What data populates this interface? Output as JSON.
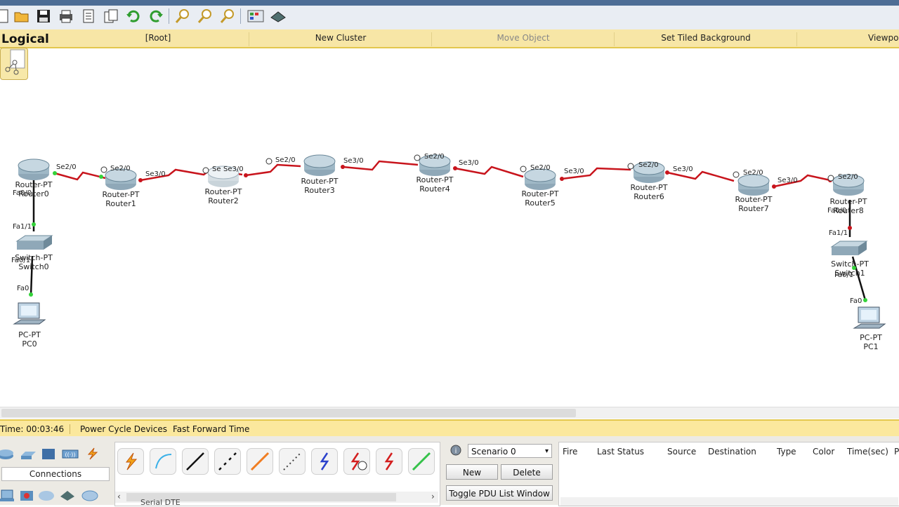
{
  "toolbar": {
    "icons": [
      "open-icon",
      "save-icon",
      "print-icon",
      "activity-wizard-icon",
      "copy-icon",
      "paste-icon",
      "undo-icon",
      "redo-icon",
      "zoom-in-icon",
      "zoom-reset-icon",
      "zoom-out-icon",
      "palette-icon",
      "custom-device-icon"
    ]
  },
  "logical_bar": {
    "label": "Logical",
    "items": [
      {
        "label": "[Root]"
      },
      {
        "label": "New Cluster"
      },
      {
        "label": "Move Object"
      },
      {
        "label": "Set Tiled Background"
      },
      {
        "label": "Viewpo"
      }
    ]
  },
  "devices": [
    {
      "type": "Router-PT",
      "name": "Router0"
    },
    {
      "type": "Router-PT",
      "name": "Router1"
    },
    {
      "type": "Router-PT",
      "name": "Router2"
    },
    {
      "type": "Router-PT",
      "name": "Router3"
    },
    {
      "type": "Router-PT",
      "name": "Router4"
    },
    {
      "type": "Router-PT",
      "name": "Router5"
    },
    {
      "type": "Router-PT",
      "name": "Router6"
    },
    {
      "type": "Router-PT",
      "name": "Router7"
    },
    {
      "type": "Router-PT",
      "name": "Router8"
    },
    {
      "type": "Switch-PT",
      "name": "Switch0"
    },
    {
      "type": "Switch-PT",
      "name": "Switch1"
    },
    {
      "type": "PC-PT",
      "name": "PC0"
    },
    {
      "type": "PC-PT",
      "name": "PC1"
    }
  ],
  "port_labels": [
    "Se2/0",
    "Se2/0",
    "Se3/0",
    "Se",
    "Se3/0",
    "Se2/0",
    "Se3/0",
    "Se2/0",
    "Se3/0",
    "Se2/0",
    "Se3/0",
    "Se2/0",
    "Se3/0",
    "Se2/0",
    "Se3/0",
    "Se2/0",
    "Fa0/0",
    "Fa1/1",
    "Fa0/1",
    "Fa0",
    "Fa0/0",
    "Fa1/1",
    "Fa0/1",
    "Fa0"
  ],
  "status": {
    "time": "Time: 00:03:46",
    "power_cycle": "Power Cycle Devices",
    "fast_forward": "Fast Forward Time"
  },
  "bottom": {
    "connections_label": "Connections",
    "connection_type_label": "Serial DTE",
    "scenario": {
      "selected": "Scenario 0",
      "new_label": "New",
      "delete_label": "Delete",
      "toggle_label": "Toggle PDU List Window"
    },
    "pdu_columns": [
      "Fire",
      "Last Status",
      "Source",
      "Destination",
      "Type",
      "Color",
      "Time(sec)",
      "P"
    ]
  },
  "colors": {
    "serial_link": "#c8141c",
    "ethernet_link": "#111111",
    "link_up": "#34d23a",
    "accent_yellow": "#f7e6a6"
  }
}
